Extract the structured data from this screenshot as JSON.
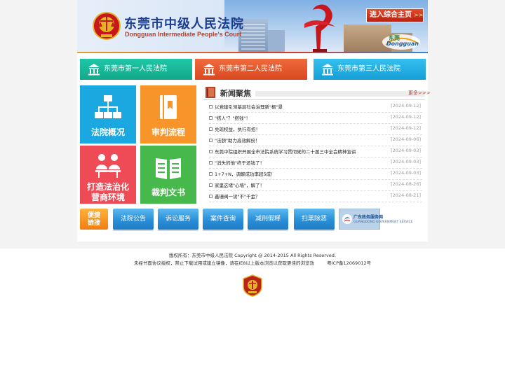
{
  "banner": {
    "title_cn": "东莞市中级人民法院",
    "title_en": "Dongguan Intermediate People's Court",
    "enter_main": "进入综合主页",
    "enter_arrow": ">>",
    "city_logo_cn": "东莞",
    "city_logo_en": "Dongguan"
  },
  "courts": [
    {
      "label": "东莞市第一人民法院"
    },
    {
      "label": "东莞市第二人民法院"
    },
    {
      "label": "东莞市第三人民法院"
    }
  ],
  "tiles": [
    {
      "label": "法院概况",
      "icon": "org-chart-icon"
    },
    {
      "label": "审判流程",
      "icon": "book-icon"
    },
    {
      "label": "打造法治化",
      "label2": "营商环境",
      "icon": "meeting-icon"
    },
    {
      "label": "裁判文书",
      "icon": "open-book-icon"
    }
  ],
  "news": {
    "title": "新闻聚焦",
    "more": "更多>>>",
    "items": [
      {
        "title": "以党建引领基层社会治理新\"枫\"景",
        "date": "[2024-09-12]"
      },
      {
        "title": "\"搭人\"？\"搭钱\"！",
        "date": "[2024-09-12]"
      },
      {
        "title": "兑现权益，执行有招！",
        "date": "[2024-09-12]"
      },
      {
        "title": "\"法颐\"助力高效解纷！",
        "date": "[2024-09-06]"
      },
      {
        "title": "东莞中院组织开展全市法院系统学习贯彻党的二十届三中全会精神宣讲",
        "date": "[2024-09-03]"
      },
      {
        "title": "\"消失的他\"终于还钱了！",
        "date": "[2024-09-03]"
      },
      {
        "title": "1+7+N，调解成功率超5成！",
        "date": "[2024-09-03]"
      },
      {
        "title": "家里这堵\"心墙\"，解了！",
        "date": "[2024-08-26]"
      },
      {
        "title": "鑫珊阀一读\"不\"千金？",
        "date": "[2024-08-21]"
      }
    ]
  },
  "quick_links": {
    "main_line1": "便捷",
    "main_line2": "链接",
    "items": [
      "法院公告",
      "诉讼服务",
      "案件查询",
      "减刑假释",
      "扫黑除恶"
    ],
    "gov_title": "广东政务服务网",
    "gov_sub": "GUANGDONG GOVERNMENT SERVICE"
  },
  "footer": {
    "copyright": "版权所有：东莞市中级人民法院 Copyright @ 2014-2015 All Rights Reserved.",
    "notice": "未经书面协议授权，禁止下载试用或建立镜像，请在IE8以上版本浏览以获取更佳的浏览效",
    "icp": "粤ICP备12069012号"
  },
  "colors": {
    "court1": "#12a98a",
    "court2": "#d9481f",
    "court3": "#159ed6",
    "tile1": "#1ba8e0",
    "tile2": "#f7952b",
    "tile3": "#ef4b57",
    "tile4": "#47b84b",
    "quick_blue": "#2a8fd8",
    "quick_orange": "#f07d0f"
  }
}
